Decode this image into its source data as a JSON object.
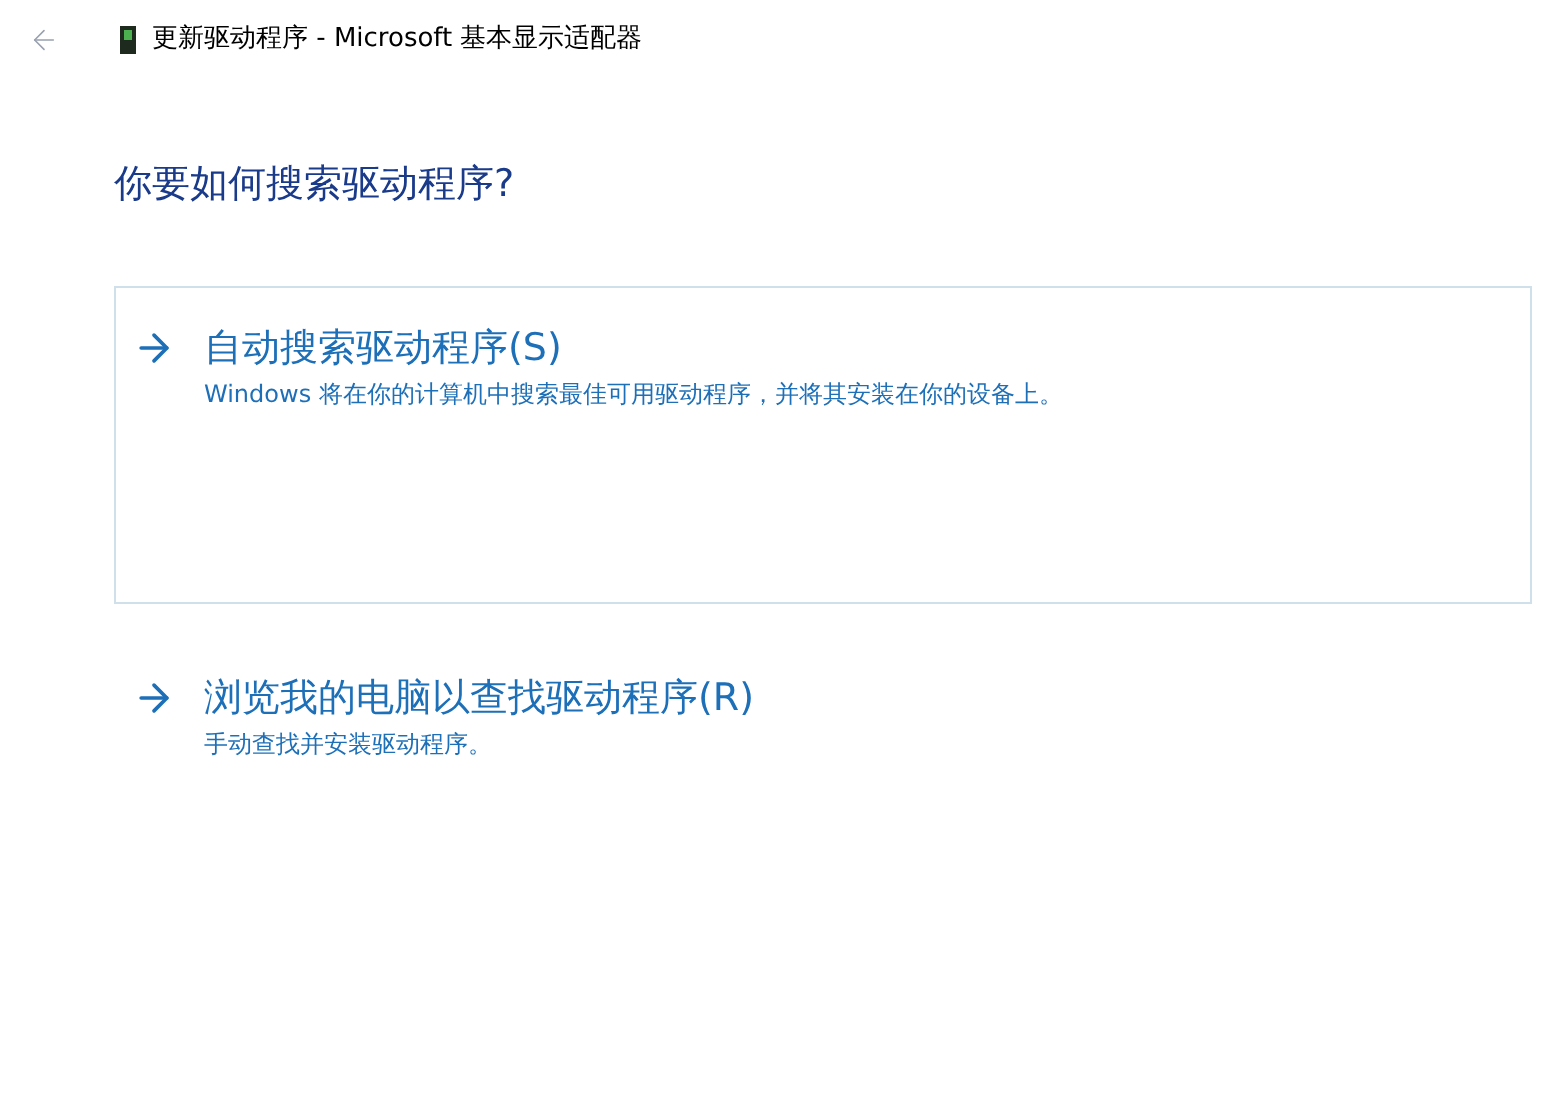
{
  "window": {
    "title": "更新驱动程序 - Microsoft 基本显示适配器"
  },
  "heading": "你要如何搜索驱动程序?",
  "options": [
    {
      "title": "自动搜索驱动程序(S)",
      "description": "Windows 将在你的计算机中搜索最佳可用驱动程序，并将其安装在你的设备上。",
      "selected": true
    },
    {
      "title": "浏览我的电脑以查找驱动程序(R)",
      "description": "手动查找并安装驱动程序。",
      "selected": false
    }
  ]
}
